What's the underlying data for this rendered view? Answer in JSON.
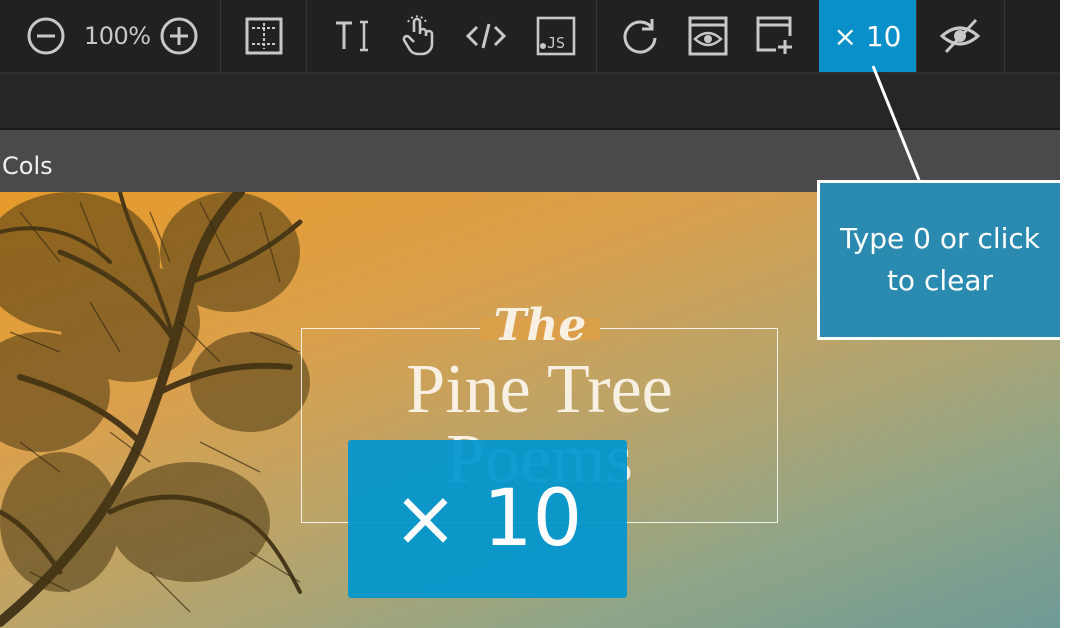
{
  "toolbar": {
    "zoom_level": "100%",
    "multiplier_label": "× 10",
    "icons": [
      "zoom-out-icon",
      "zoom-in-icon",
      "layout-grid-icon",
      "text-cursor-icon",
      "touch-icon",
      "code-icon",
      "javascript-icon",
      "refresh-icon",
      "preview-icon",
      "add-window-icon",
      "hide-icon"
    ]
  },
  "panel": {
    "cols_label": "Cols"
  },
  "hero": {
    "title_the": "The",
    "title_line1": "Pine Tree",
    "title_line2": "Poems"
  },
  "overlay": {
    "multiplier_big": "× 10"
  },
  "tooltip": {
    "text": "Type 0 or click to clear"
  },
  "colors": {
    "toolbar_bg": "#212121",
    "accent": "#0a90c8",
    "tooltip_bg": "#2a8ab0"
  }
}
